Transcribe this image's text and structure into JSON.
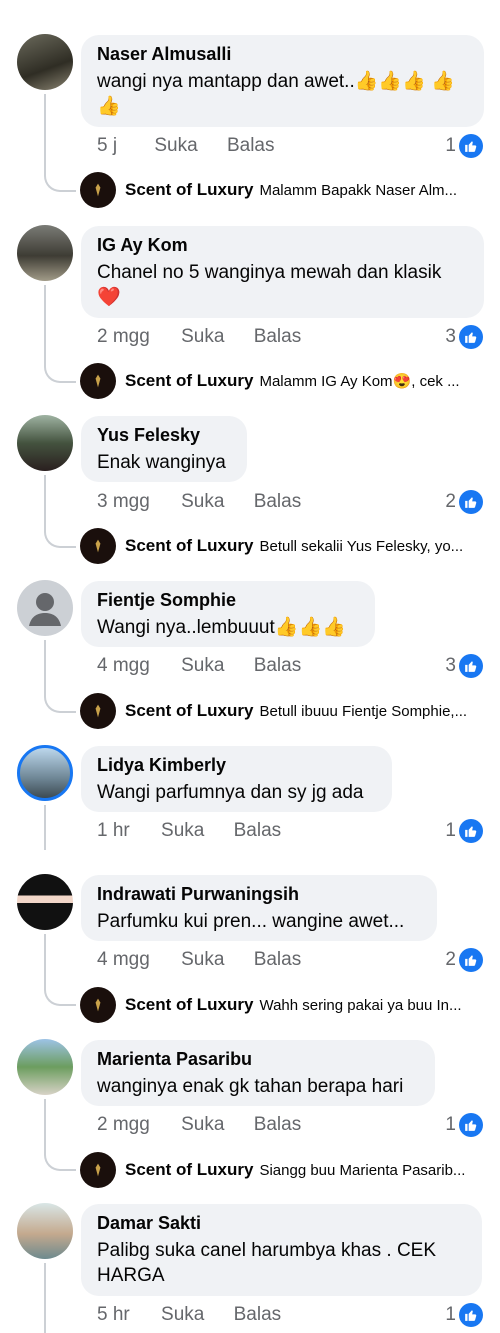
{
  "comments": [
    {
      "name": "Naser Almusalli",
      "text": "wangi nya mantapp dan awet..👍👍👍 👍👍",
      "time": "5 j",
      "like_label": "Suka",
      "reply_label": "Balas",
      "likes": "1",
      "reply": {
        "name": "Scent of Luxury",
        "text": "Malamm Bapakk Naser Alm..."
      }
    },
    {
      "name": "IG Ay Kom",
      "text": "Chanel no 5 wanginya mewah dan klasik ❤️",
      "time": "2 mgg",
      "like_label": "Suka",
      "reply_label": "Balas",
      "likes": "3",
      "reply": {
        "name": "Scent of Luxury",
        "text": "Malamm IG Ay Kom😍, cek ..."
      }
    },
    {
      "name": "Yus Felesky",
      "text": "Enak wanginya",
      "time": "3 mgg",
      "like_label": "Suka",
      "reply_label": "Balas",
      "likes": "2",
      "reply": {
        "name": "Scent of Luxury",
        "text": "Betull sekalii Yus Felesky, yo..."
      }
    },
    {
      "name": "Fientje Somphie",
      "text": "Wangi nya..lembuuut👍👍👍",
      "time": "4 mgg",
      "like_label": "Suka",
      "reply_label": "Balas",
      "likes": "3",
      "reply": {
        "name": "Scent of Luxury",
        "text": "Betull ibuuu Fientje Somphie,..."
      }
    },
    {
      "name": "Lidya Kimberly",
      "text": "Wangi parfumnya dan sy jg ada",
      "time": "1 hr",
      "like_label": "Suka",
      "reply_label": "Balas",
      "likes": "1"
    },
    {
      "name": "Indrawati Purwaningsih",
      "text": "Parfumku kui pren... wangine awet...",
      "time": "4 mgg",
      "like_label": "Suka",
      "reply_label": "Balas",
      "likes": "2",
      "reply": {
        "name": "Scent of Luxury",
        "text": "Wahh sering pakai ya buu In..."
      }
    },
    {
      "name": "Marienta Pasaribu",
      "text": "wanginya enak gk tahan berapa hari",
      "time": "2 mgg",
      "like_label": "Suka",
      "reply_label": "Balas",
      "likes": "1",
      "reply": {
        "name": "Scent of Luxury",
        "text": "Siangg buu Marienta Pasarib..."
      }
    },
    {
      "name": "Damar Sakti",
      "text": "Palibg suka canel harumbya khas . CEK HARGA",
      "time": "5 hr",
      "like_label": "Suka",
      "reply_label": "Balas",
      "likes": "1"
    }
  ],
  "colors": {
    "like_blue": "#1877f2",
    "bubble": "#f0f2f5",
    "meta": "#65676b"
  }
}
